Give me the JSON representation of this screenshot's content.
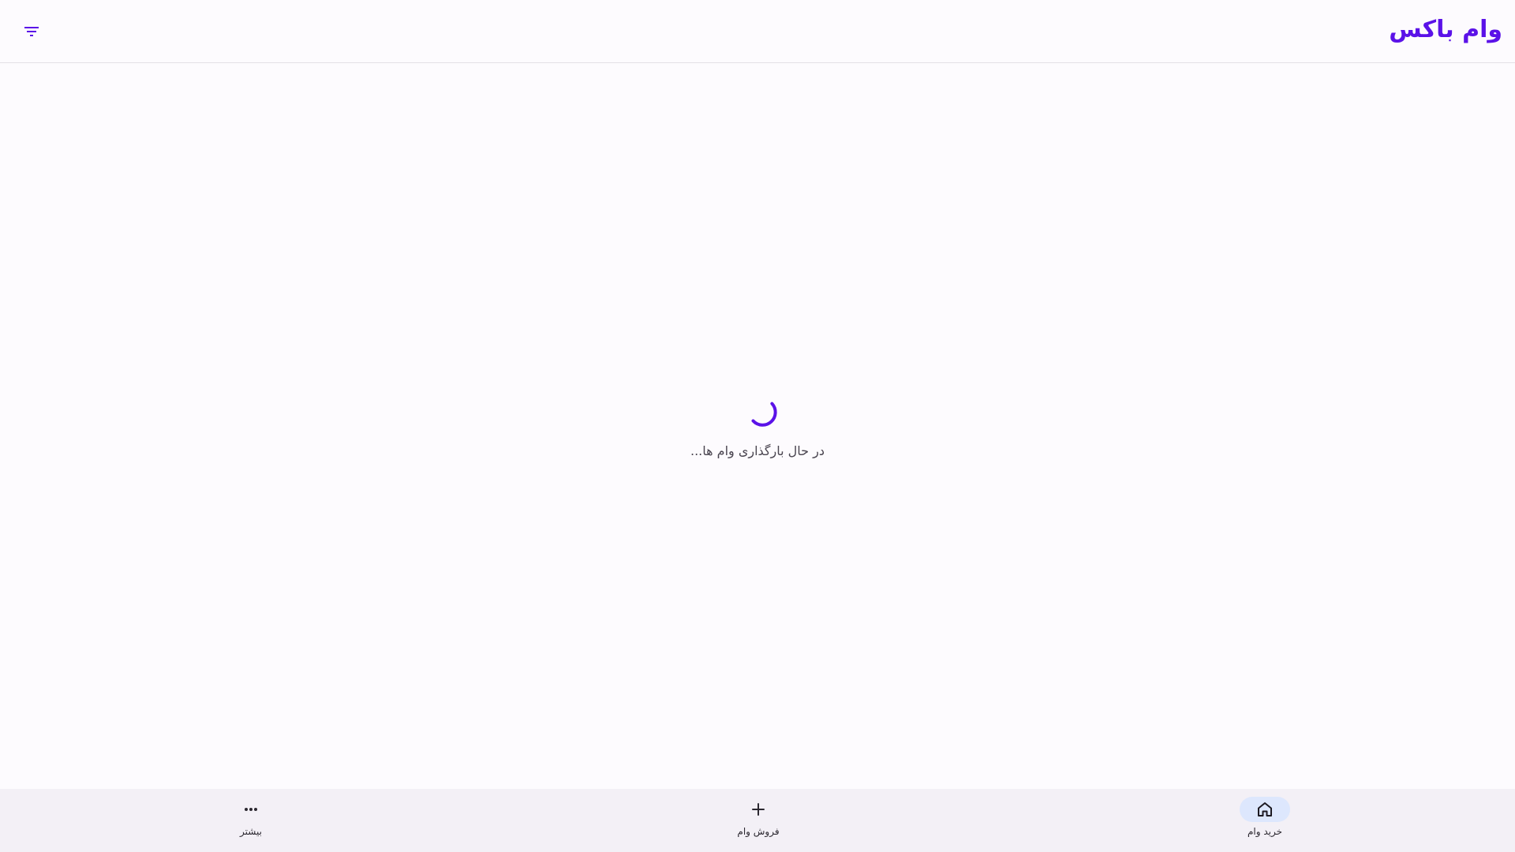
{
  "header": {
    "title": "وام باکس",
    "filter_icon": "filter-list-icon"
  },
  "main": {
    "loading_text": "در حال بارگذاری وام ها..."
  },
  "bottom_nav": {
    "items": [
      {
        "label": "خرید وام",
        "icon": "home-icon",
        "active": true
      },
      {
        "label": "فروش وام",
        "icon": "plus-icon",
        "active": false
      },
      {
        "label": "بیشتر",
        "icon": "more-horizontal-icon",
        "active": false
      }
    ]
  },
  "colors": {
    "accent": "#5b12e8",
    "background": "#fdfbfe",
    "nav_background": "#f3f0f6",
    "active_pill": "#dde7fd"
  }
}
